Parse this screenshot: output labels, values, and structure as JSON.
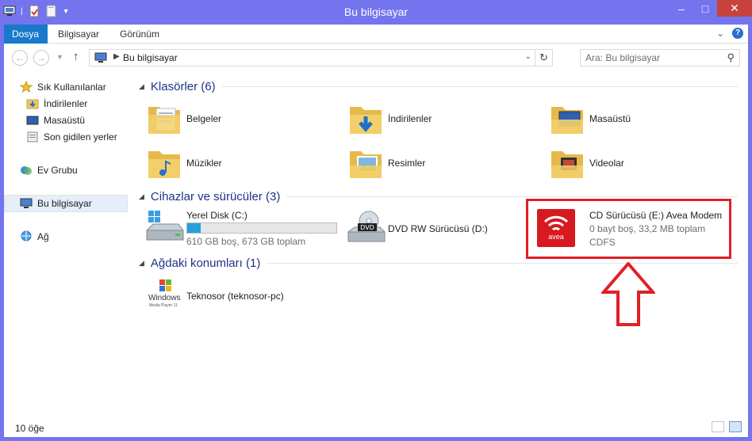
{
  "window": {
    "title": "Bu bilgisayar"
  },
  "window_buttons": {
    "minimize": "–",
    "maximize": "□",
    "close": "✕"
  },
  "ribbon": {
    "tabs": [
      "Dosya",
      "Bilgisayar",
      "Görünüm"
    ],
    "expand": "⌄",
    "help": "?"
  },
  "address": {
    "path": "Bu bilgisayar",
    "search_placeholder": "Ara: Bu bilgisayar"
  },
  "sidebar": {
    "items": [
      {
        "label": "Sık Kullanılanlar",
        "icon": "star-icon"
      },
      {
        "label": "İndirilenler",
        "icon": "downloads-folder-icon"
      },
      {
        "label": "Masaüstü",
        "icon": "desktop-icon"
      },
      {
        "label": "Son gidilen yerler",
        "icon": "recent-places-icon"
      },
      {
        "label": "Ev Grubu",
        "icon": "homegroup-icon"
      },
      {
        "label": "Bu bilgisayar",
        "icon": "computer-icon"
      },
      {
        "label": "Ağ",
        "icon": "network-icon"
      }
    ]
  },
  "groups": {
    "folders": "Klasörler (6)",
    "devices": "Cihazlar ve sürücüler (3)",
    "network": "Ağdaki konumları (1)"
  },
  "folders": [
    {
      "label": "Belgeler",
      "icon": "documents-folder-icon"
    },
    {
      "label": "İndirilenler",
      "icon": "downloads-folder-icon"
    },
    {
      "label": "Masaüstü",
      "icon": "desktop-folder-icon"
    },
    {
      "label": "Müzikler",
      "icon": "music-folder-icon"
    },
    {
      "label": "Resimler",
      "icon": "pictures-folder-icon"
    },
    {
      "label": "Videolar",
      "icon": "videos-folder-icon"
    }
  ],
  "drives": [
    {
      "label": "Yerel Disk (C:)",
      "free_text": "610 GB boş, 673 GB toplam",
      "used_fraction": 0.09,
      "icon": "hard-disk-icon"
    },
    {
      "label": "DVD RW Sürücüsü (D:)",
      "icon": "dvd-drive-icon"
    },
    {
      "label": "CD Sürücüsü (E:) Avea Modem",
      "free_text": "0 bayt boş, 33,2 MB toplam",
      "fs": "CDFS",
      "icon": "avea-modem-icon",
      "logo_text": "avea"
    }
  ],
  "network_locations": [
    {
      "label": "Teknosor (teknosor-pc)",
      "icon": "windows-media-player-icon",
      "icon_text_1": "Windows",
      "icon_text_2": "Media Player 11"
    }
  ],
  "status": {
    "item_count": "10 öğe"
  },
  "colors": {
    "accent": "#1979ca",
    "highlight": "#e11f25",
    "avea": "#d71920",
    "titlebar": "#7474ee"
  }
}
